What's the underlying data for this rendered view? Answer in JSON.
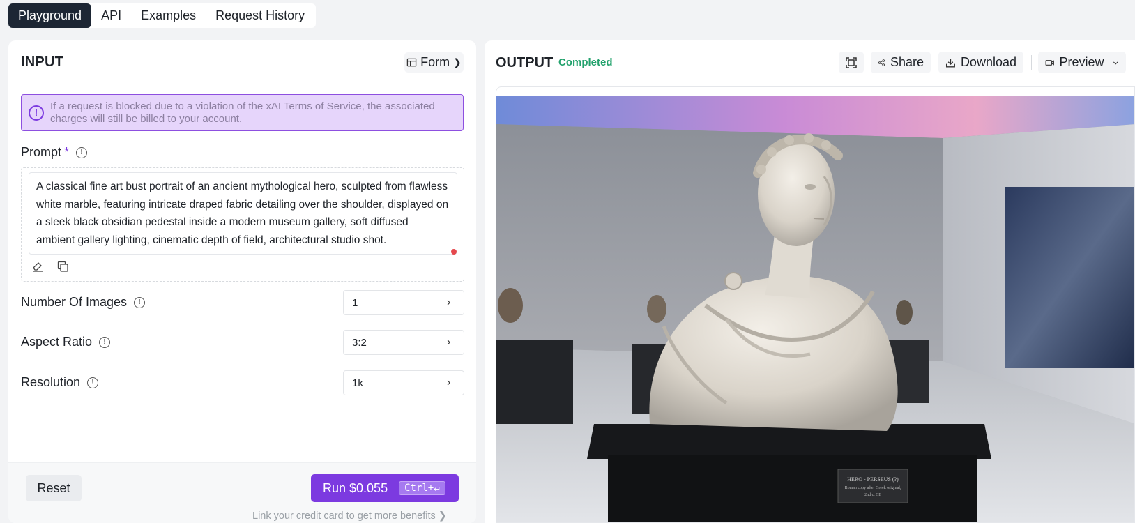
{
  "tabs": [
    {
      "label": "Playground",
      "active": true
    },
    {
      "label": "API",
      "active": false
    },
    {
      "label": "Examples",
      "active": false
    },
    {
      "label": "Request History",
      "active": false
    }
  ],
  "input": {
    "title": "INPUT",
    "form_label": "Form",
    "notice": "If a request is blocked due to a violation of the xAI Terms of Service, the associated charges will still be billed to your account.",
    "prompt_label": "Prompt",
    "prompt_required": "*",
    "prompt_value": "A classical fine art bust portrait of an ancient mythological hero, sculpted from flawless white marble, featuring intricate draped fabric detailing over the shoulder, displayed on a sleek black obsidian pedestal inside a modern museum gallery, soft diffused ambient gallery lighting, cinematic depth of field, architectural studio shot.",
    "fields": [
      {
        "label": "Number Of Images",
        "value": "1"
      },
      {
        "label": "Aspect Ratio",
        "value": "3:2"
      },
      {
        "label": "Resolution",
        "value": "1k"
      }
    ],
    "reset_label": "Reset",
    "run_label": "Run $0.055",
    "run_shortcut": "Ctrl+↵",
    "credit_note": "Link your credit card to get more benefits ❯"
  },
  "output": {
    "title": "OUTPUT",
    "status": "Completed",
    "status_color": "#23a26d",
    "share_label": "Share",
    "download_label": "Download",
    "preview_label": "Preview",
    "plaque_line1": "HERO - PERSEUS (?)",
    "plaque_line2": "Roman copy after Greek original,",
    "plaque_line3": "2nd c. CE"
  },
  "colors": {
    "accent": "#7c3ae0",
    "notice_bg": "#e6d5fb",
    "tab_active_bg": "#1d2634"
  },
  "icons": [
    "form-icon",
    "info-icon",
    "eraser-icon",
    "copy-icon",
    "fullscreen-icon",
    "share-icon",
    "download-icon",
    "video-icon",
    "chevron-down-icon",
    "chevron-right-icon"
  ]
}
